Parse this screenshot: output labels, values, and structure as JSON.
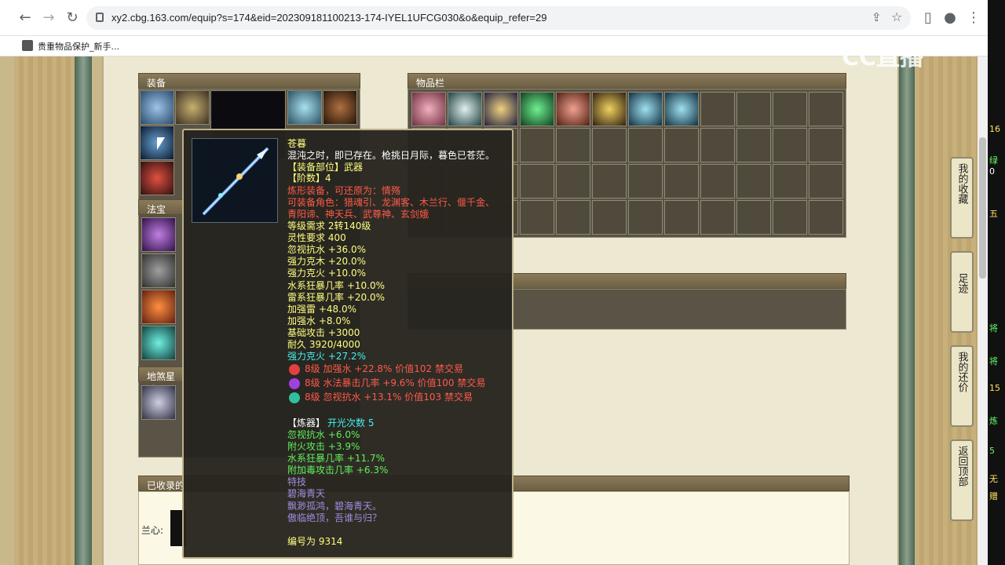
{
  "browser": {
    "url": "xy2.cbg.163.com/equip?s=174&eid=202309181100213-174-IYEL1UFCG030&o&equip_refer=29",
    "bookmark": "贵重物品保护_新手..."
  },
  "watermark": "CC直播",
  "panels": {
    "equip_title": "装备",
    "items_title": "物品栏",
    "fabao_title": "法宝",
    "dishaxing_title": "地煞星阶",
    "collected_title": "已收录的",
    "lanxin_label": "兰心:"
  },
  "tooltip": {
    "name": "苍暮",
    "desc": "混沌之时，即已存在。枪挑日月际，暮色已苍茫。",
    "slot": "【装备部位】武器",
    "tier": "【阶数】4",
    "transform": "炼形装备，可还原为：情殇",
    "roles": "可装备角色：猎魂引、龙渊客、木兰行、偃千金、",
    "roles2": "青阳谛、神天兵、武尊神、玄剑娥",
    "level_req": "等级需求 2转140级",
    "spirit_req": "灵性要求 400",
    "attrs": [
      "忽视抗水 +36.0%",
      "强力克木 +20.0%",
      "强力克火 +10.0%",
      "水系狂暴几率 +10.0%",
      "雷系狂暴几率 +20.0%",
      "加强雷 +48.0%",
      "加强水 +8.0%",
      "基础攻击 +3000",
      "耐久 3920/4000"
    ],
    "special": "强力克火 +27.2%",
    "gems": [
      {
        "text": "8级 加强水 +22.8% 价值102 禁交易",
        "color": "#ff4040"
      },
      {
        "text": "8级 水法暴击几率 +9.6% 价值100 禁交易",
        "color": "#b040f0"
      },
      {
        "text": "8级 忽视抗水 +13.1% 价值103 禁交易",
        "color": "#30c0a0"
      }
    ],
    "refine_label": "【炼器】",
    "refine_count": "开光次数 5",
    "refine_attrs": [
      "忽视抗水 +6.0%",
      "附火攻击 +3.9%",
      "水系狂暴几率 +11.7%",
      "附加毒攻击几率 +6.3%"
    ],
    "skill_label": "特技",
    "skill_name": "碧海青天",
    "poem1": "飘渺孤鸿，碧海青天。",
    "poem2": "傲临绝顶，吾谁与归？",
    "serial": "编号为 9314"
  },
  "float_buttons": [
    "我的收藏",
    "足迹",
    "我的还价",
    "返回顶部"
  ],
  "strip_text": [
    "16",
    "绿",
    "0",
    "五",
    "将",
    "将",
    "15",
    "炼",
    "5",
    "无",
    "赠"
  ]
}
